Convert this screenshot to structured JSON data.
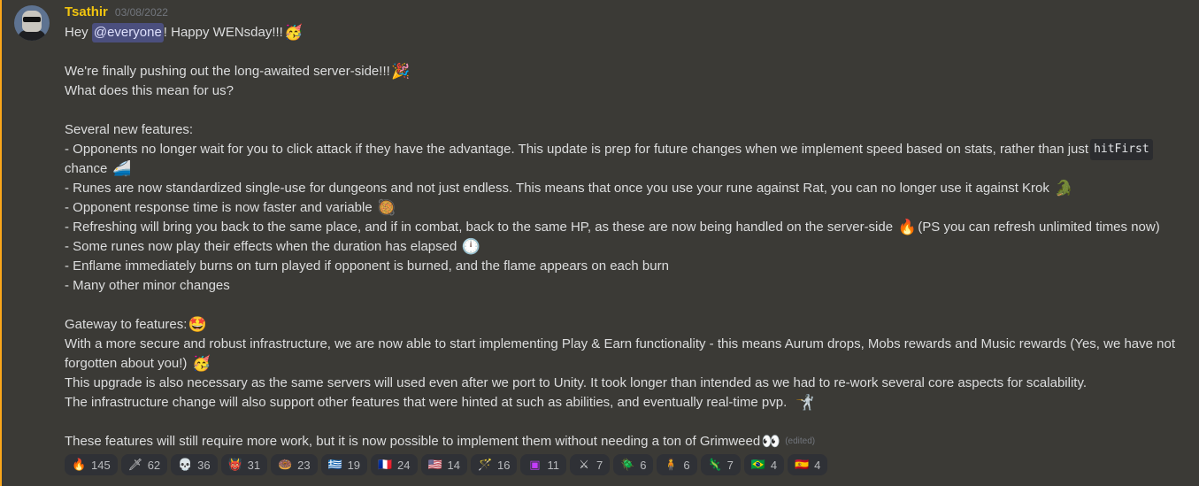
{
  "author": {
    "name": "Tsathir",
    "timestamp": "03/08/2022"
  },
  "colors": {
    "username": "#f1c40f",
    "mention_bg": "#4b4f7e",
    "accent_bar": "#faa61a"
  },
  "message": {
    "l1_pre": "Hey ",
    "mention": "@everyone",
    "l1_post": "! Happy WENsday!!!",
    "l1_emoji": "🥳",
    "l2": "We're finally pushing out the long-awaited server-side!!!",
    "l2_emoji": "🎉",
    "l3": "What does this mean for us?",
    "l4": "Several new features:",
    "l5": "- Opponents no longer wait for you to click attack if they have the advantage. This update is prep for future changes when we implement speed based on stats, rather than just",
    "l5_code": "hitFirst",
    "l6": "chance",
    "l6_emoji": "🚄",
    "l7": "- Runes are now standardized single-use for dungeons and not just endless. This means that once you use your rune against Rat, you can no longer use it against Krok",
    "l7_emoji": "🐊",
    "l8": "- Opponent response time is now faster and variable",
    "l8_emoji": "🥘",
    "l9": "- Refreshing will bring you back to the same place, and if in combat, back to the same HP, as these are now being handled on the server-side",
    "l9_emoji": "🔥",
    "l9_post": " (PS you can refresh unlimited times now)",
    "l10": "- Some runes now play their effects when the duration has elapsed",
    "l10_emoji": "🕛",
    "l11": "- Enflame immediately burns on turn played if opponent is burned, and the flame appears on each burn",
    "l12": "- Many other minor changes",
    "l13": "Gateway to features:",
    "l13_emoji": "🤩",
    "l14": "With a more secure and robust infrastructure, we are now able to start implementing Play & Earn functionality - this means Aurum drops, Mobs rewards and Music rewards (Yes, we have not forgotten about you!)",
    "l14_emoji": "🥳",
    "l15": "This upgrade is also necessary as the same servers will used even after we port to Unity. It took longer than intended as we had to re-work several core aspects for scalability.",
    "l16": "The infrastructure change will also support other features that were hinted at such as abilities, and eventually real-time pvp.",
    "l16_emoji": "🤺",
    "l17": "These features will still require more work, but it is now possible to implement them without needing a ton of Grimweed",
    "l17_emoji": "👀",
    "edited": "(edited)"
  },
  "reactions": [
    {
      "emoji": "🔥",
      "icon": "fire-icon",
      "count": "145"
    },
    {
      "emoji": "🗡",
      "icon": "sword-icon",
      "count": "62"
    },
    {
      "emoji": "💀",
      "icon": "skull-icon",
      "count": "36"
    },
    {
      "emoji": "👹",
      "icon": "monster-icon",
      "count": "31"
    },
    {
      "emoji": "🍩",
      "icon": "ring-icon",
      "count": "23"
    },
    {
      "emoji": "🇬🇷",
      "icon": "greece-flag-icon",
      "count": "19"
    },
    {
      "emoji": "🇫🇷",
      "icon": "france-flag-icon",
      "count": "24"
    },
    {
      "emoji": "🇺🇸",
      "icon": "usa-flag-icon",
      "count": "14"
    },
    {
      "emoji": "🪄",
      "icon": "wand-icon",
      "count": "16"
    },
    {
      "emoji": "▣",
      "icon": "purple-square-icon",
      "count": "11"
    },
    {
      "emoji": "⚔",
      "icon": "crossed-swords-icon",
      "count": "7"
    },
    {
      "emoji": "🪲",
      "icon": "bug-icon",
      "count": "6"
    },
    {
      "emoji": "🧍",
      "icon": "character-icon",
      "count": "6"
    },
    {
      "emoji": "🦎",
      "icon": "lizard-icon",
      "count": "7"
    },
    {
      "emoji": "🇧🇷",
      "icon": "brazil-flag-icon",
      "count": "4"
    },
    {
      "emoji": "🇪🇸",
      "icon": "spain-flag-icon",
      "count": "4"
    }
  ]
}
